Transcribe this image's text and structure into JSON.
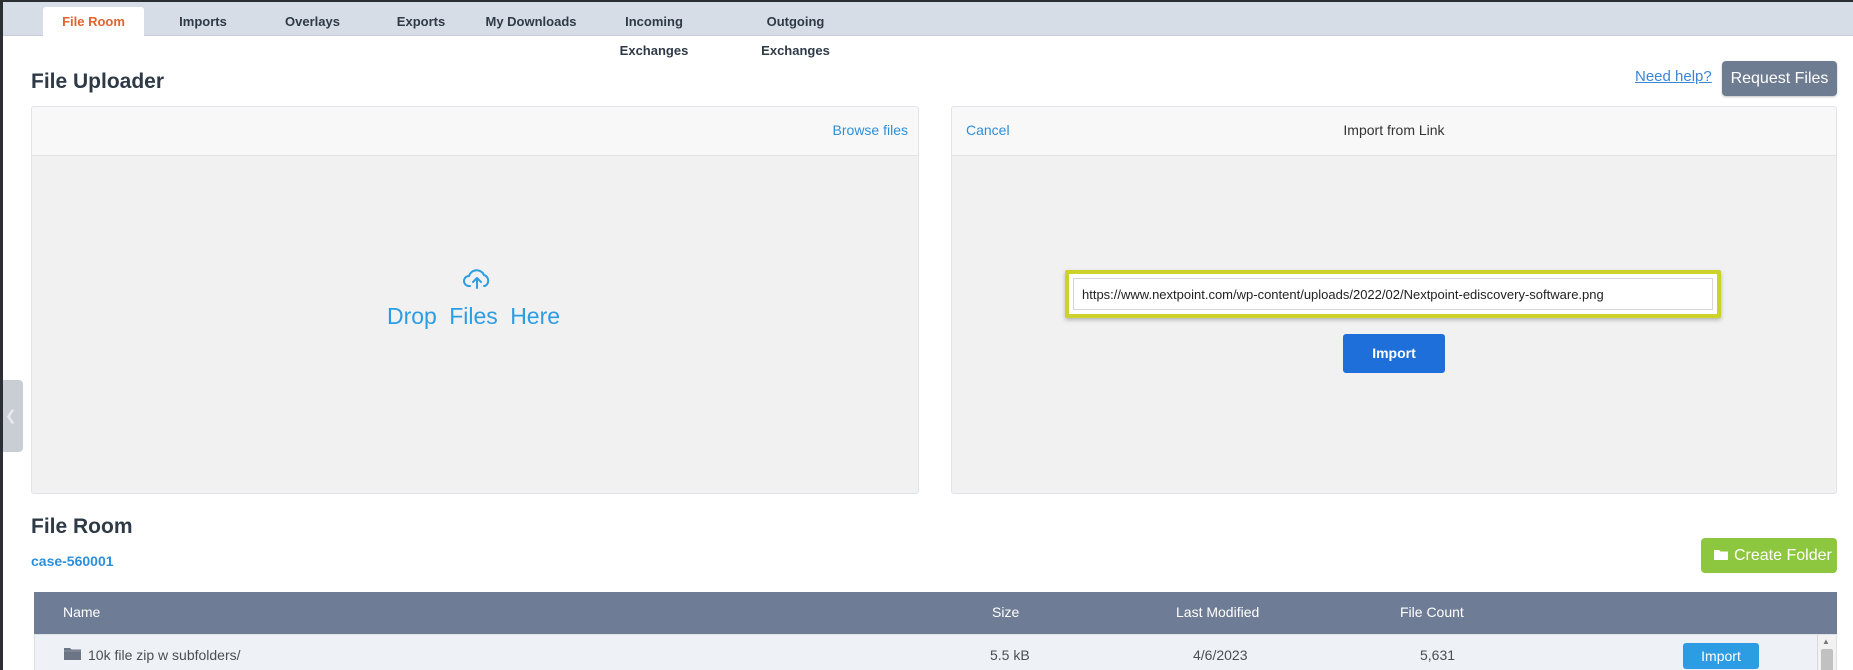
{
  "tabs": [
    {
      "label": "File Room",
      "active": true
    },
    {
      "label": "Imports"
    },
    {
      "label": "Overlays"
    },
    {
      "label": "Exports"
    },
    {
      "label": "My Downloads"
    },
    {
      "label": "Incoming Exchanges"
    },
    {
      "label": "Outgoing Exchanges"
    }
  ],
  "uploader": {
    "title": "File Uploader",
    "help_label": "Need help?",
    "request_label": "Request Files",
    "browse_label": "Browse files",
    "drop_label": "Drop Files Here",
    "drop_icon": "cloud-upload-icon"
  },
  "import_link": {
    "cancel_label": "Cancel",
    "title": "Import from Link",
    "url_value": "https://www.nextpoint.com/wp-content/uploads/2022/02/Nextpoint-ediscovery-software.png",
    "import_label": "Import",
    "highlight_color": "#ccd22a"
  },
  "file_room": {
    "title": "File Room",
    "case_label": "case-560001",
    "create_folder_label": "Create Folder",
    "columns": {
      "name": "Name",
      "size": "Size",
      "modified": "Last Modified",
      "count": "File Count"
    },
    "rows": [
      {
        "name": "10k file zip w subfolders/",
        "size": "5.5 kB",
        "modified": "4/6/2023",
        "count": "5,631",
        "action": "Import",
        "icon": "folder-icon"
      }
    ]
  },
  "colors": {
    "active_tab": "#e0642c",
    "link": "#2d8fd9",
    "primary_button": "#1e6fd9",
    "success_button": "#8dc63f",
    "table_header": "#6e7c95"
  }
}
